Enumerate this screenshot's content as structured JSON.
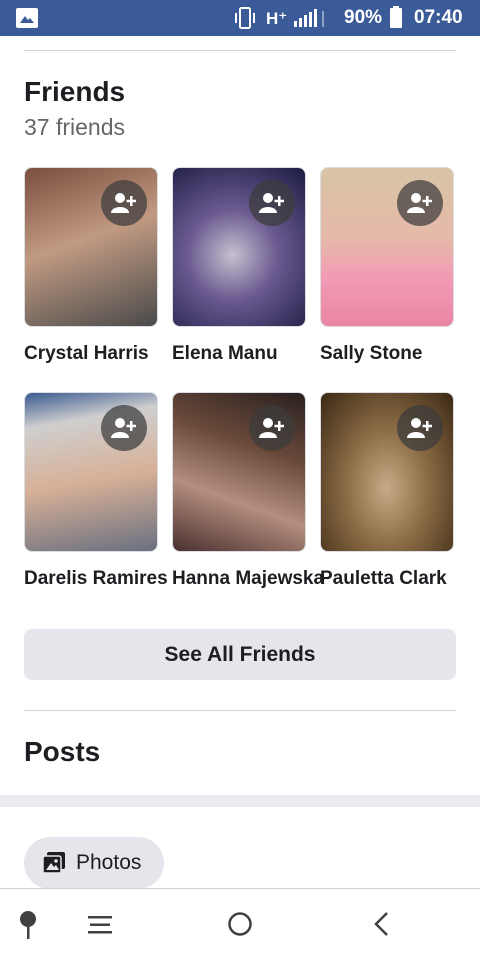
{
  "status_bar": {
    "network_type": "H⁺",
    "battery_percent": "90%",
    "time": "07:40",
    "icons": [
      "gallery-icon",
      "vibrate-icon",
      "signal-icon",
      "battery-icon"
    ]
  },
  "friends": {
    "title": "Friends",
    "count_label": "37 friends",
    "list": [
      {
        "name": "Crystal Harris",
        "photo_colors": [
          "#7a5a4a",
          "#c9a48a",
          "#3a3a3a"
        ]
      },
      {
        "name": "Elena Manu",
        "photo_colors": [
          "#2a2a5a",
          "#b7b0c8",
          "#4a3a70"
        ]
      },
      {
        "name": "Sally Stone",
        "photo_colors": [
          "#d9c6a8",
          "#f2a3b7",
          "#e88aa6"
        ]
      },
      {
        "name": "Darelis Ramires",
        "photo_colors": [
          "#c8c8c8",
          "#d9b49a",
          "#5a6a7a"
        ]
      },
      {
        "name": "Hanna Majewska",
        "photo_colors": [
          "#3a2a2a",
          "#b08a7a",
          "#6a4a3a"
        ]
      },
      {
        "name": "Pauletta Clark",
        "photo_colors": [
          "#6a5030",
          "#c7a884",
          "#3a2a1a"
        ]
      }
    ],
    "see_all_label": "See All Friends"
  },
  "posts": {
    "title": "Posts",
    "photos_chip_label": "Photos"
  },
  "nav_bar": {
    "icons": [
      "pin-icon",
      "menu-icon",
      "home-icon",
      "back-icon"
    ]
  },
  "colors": {
    "status_bar": "#3b5b98",
    "button_bg": "#e4e6eb",
    "secondary_text": "#65676b",
    "primary_text": "#1c1e21"
  }
}
